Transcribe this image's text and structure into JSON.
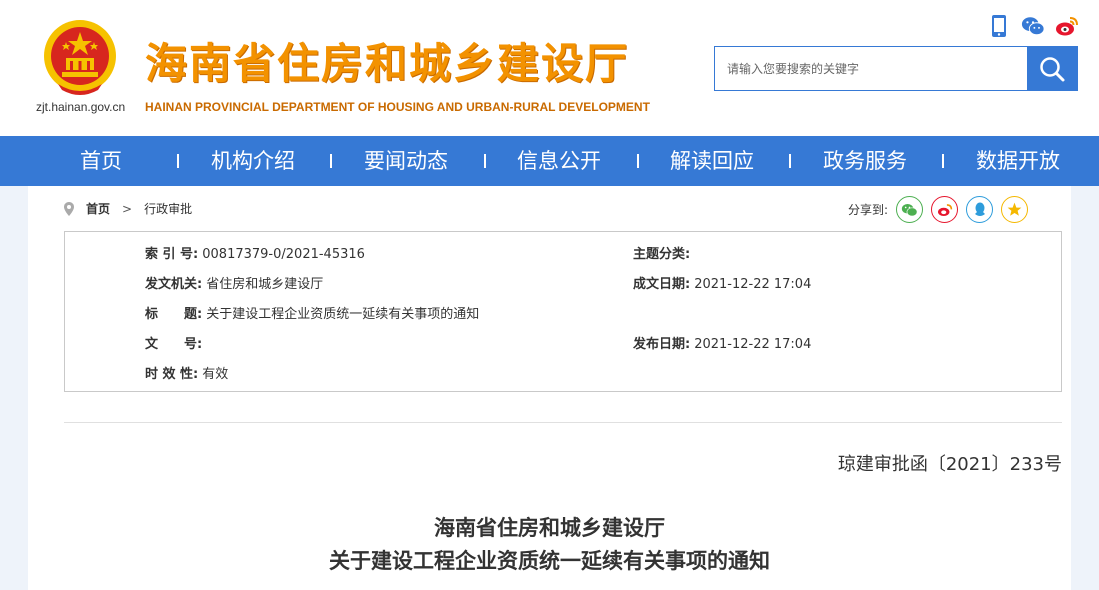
{
  "header": {
    "title": "海南省住房和城乡建设厅",
    "title_en": "HAINAN PROVINCIAL DEPARTMENT OF HOUSING AND URBAN-RURAL DEVELOPMENT",
    "domain": "zjt.hainan.gov.cn",
    "icons": [
      "mobile-icon",
      "wechat-icon",
      "weibo-icon"
    ]
  },
  "search": {
    "placeholder": "请输入您要搜索的关键字",
    "value": ""
  },
  "nav": {
    "items": [
      {
        "label": "首页"
      },
      {
        "label": "机构介绍"
      },
      {
        "label": "要闻动态"
      },
      {
        "label": "信息公开"
      },
      {
        "label": "解读回应"
      },
      {
        "label": "政务服务"
      },
      {
        "label": "数据开放"
      }
    ]
  },
  "breadcrumb": {
    "home": "首页",
    "separator": ">",
    "current": "行政审批"
  },
  "share": {
    "label": "分享到:",
    "targets": [
      "wechat-share-icon",
      "weibo-share-icon",
      "qq-share-icon",
      "qzone-share-icon"
    ]
  },
  "info": {
    "index_label": "索 引 号:",
    "index_value": "00817379-0/2021-45316",
    "topic_label": "主题分类:",
    "topic_value": "",
    "issuer_label": "发文机关:",
    "issuer_value": "省住房和城乡建设厅",
    "created_label": "成文日期:",
    "created_value": "2021-12-22 17:04",
    "title_label": "标　　题:",
    "title_value": "关于建设工程企业资质统一延续有关事项的通知",
    "docnum_label": "文　　号:",
    "docnum_value": "",
    "published_label": "发布日期:",
    "published_value": "2021-12-22 17:04",
    "validity_label": "时 效 性:",
    "validity_value": "有效"
  },
  "document": {
    "number": "琼建审批函〔2021〕233号",
    "title_line1": "海南省住房和城乡建设厅",
    "title_line2": "关于建设工程企业资质统一延续有关事项的通知"
  },
  "colors": {
    "primary": "#3679d5",
    "title_orange": "#f39200",
    "emblem_red": "#d7261e",
    "emblem_gold": "#f6c200"
  }
}
